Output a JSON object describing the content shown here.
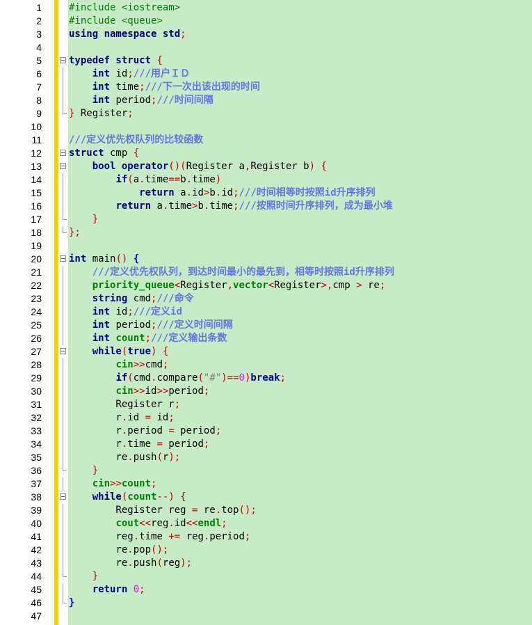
{
  "editor": {
    "lines": [
      {
        "n": "1",
        "fold": "none",
        "segs": [
          [
            "pp",
            "#include <iostream>"
          ]
        ]
      },
      {
        "n": "2",
        "fold": "none",
        "segs": [
          [
            "pp",
            "#include <queue>"
          ]
        ]
      },
      {
        "n": "3",
        "fold": "none",
        "segs": [
          [
            "kw",
            "using namespace "
          ],
          [
            "kw",
            "std"
          ],
          [
            "op",
            ";"
          ]
        ]
      },
      {
        "n": "4",
        "fold": "none",
        "segs": []
      },
      {
        "n": "5",
        "fold": "open",
        "segs": [
          [
            "kw",
            "typedef struct "
          ],
          [
            "op",
            "{"
          ]
        ]
      },
      {
        "n": "6",
        "fold": "line",
        "segs": [
          [
            "fn",
            "    "
          ],
          [
            "kw",
            "int"
          ],
          [
            "fn",
            " id"
          ],
          [
            "op",
            ";"
          ],
          [
            "cm",
            "///用户ＩＤ"
          ]
        ]
      },
      {
        "n": "7",
        "fold": "line",
        "segs": [
          [
            "fn",
            "    "
          ],
          [
            "kw",
            "int"
          ],
          [
            "fn",
            " time"
          ],
          [
            "op",
            ";"
          ],
          [
            "cm",
            "///下一次出该出现的时间"
          ]
        ]
      },
      {
        "n": "8",
        "fold": "line",
        "segs": [
          [
            "fn",
            "    "
          ],
          [
            "kw",
            "int"
          ],
          [
            "fn",
            " period"
          ],
          [
            "op",
            ";"
          ],
          [
            "cm",
            "///时间间隔"
          ]
        ]
      },
      {
        "n": "9",
        "fold": "end",
        "segs": [
          [
            "op",
            "}"
          ],
          [
            "fn",
            " Register"
          ],
          [
            "op",
            ";"
          ]
        ]
      },
      {
        "n": "10",
        "fold": "none",
        "segs": []
      },
      {
        "n": "11",
        "fold": "none",
        "segs": [
          [
            "cm",
            "///定义优先权队列的比较函数"
          ]
        ]
      },
      {
        "n": "12",
        "fold": "open",
        "segs": [
          [
            "kw",
            "struct"
          ],
          [
            "fn",
            " cmp "
          ],
          [
            "op",
            "{"
          ]
        ]
      },
      {
        "n": "13",
        "fold": "open",
        "segs": [
          [
            "fn",
            "    "
          ],
          [
            "kw",
            "bool operator"
          ],
          [
            "op",
            "()("
          ],
          [
            "fn",
            "Register a"
          ],
          [
            "op",
            ","
          ],
          [
            "fn",
            "Register b"
          ],
          [
            "op",
            ") {"
          ]
        ]
      },
      {
        "n": "14",
        "fold": "line",
        "segs": [
          [
            "fn",
            "        "
          ],
          [
            "kw",
            "if"
          ],
          [
            "op",
            "("
          ],
          [
            "fn",
            "a"
          ],
          [
            "op",
            "."
          ],
          [
            "fn",
            "time"
          ],
          [
            "op",
            "=="
          ],
          [
            "fn",
            "b"
          ],
          [
            "op",
            "."
          ],
          [
            "fn",
            "time"
          ],
          [
            "op",
            ")"
          ]
        ]
      },
      {
        "n": "15",
        "fold": "line",
        "segs": [
          [
            "fn",
            "            "
          ],
          [
            "kw",
            "return"
          ],
          [
            "fn",
            " a"
          ],
          [
            "op",
            "."
          ],
          [
            "fn",
            "id"
          ],
          [
            "op",
            ">"
          ],
          [
            "fn",
            "b"
          ],
          [
            "op",
            "."
          ],
          [
            "fn",
            "id"
          ],
          [
            "op",
            ";"
          ],
          [
            "cm",
            "///时间相等时按照id升序排列"
          ]
        ]
      },
      {
        "n": "16",
        "fold": "line",
        "segs": [
          [
            "fn",
            "        "
          ],
          [
            "kw",
            "return"
          ],
          [
            "fn",
            " a"
          ],
          [
            "op",
            "."
          ],
          [
            "fn",
            "time"
          ],
          [
            "op",
            ">"
          ],
          [
            "fn",
            "b"
          ],
          [
            "op",
            "."
          ],
          [
            "fn",
            "time"
          ],
          [
            "op",
            ";"
          ],
          [
            "cm",
            "///按照时间升序排列，成为最小堆"
          ]
        ]
      },
      {
        "n": "17",
        "fold": "end",
        "segs": [
          [
            "fn",
            "    "
          ],
          [
            "op",
            "}"
          ]
        ]
      },
      {
        "n": "18",
        "fold": "end",
        "segs": [
          [
            "op",
            "};"
          ]
        ]
      },
      {
        "n": "19",
        "fold": "none",
        "segs": []
      },
      {
        "n": "20",
        "fold": "open",
        "segs": [
          [
            "kw",
            "int"
          ],
          [
            "fn",
            " main"
          ],
          [
            "op",
            "() "
          ],
          [
            "br",
            "{"
          ]
        ]
      },
      {
        "n": "21",
        "fold": "line",
        "segs": [
          [
            "fn",
            "    "
          ],
          [
            "cm",
            "///定义优先权队列，到达时间最小的最先到，相等时按照id升序排列"
          ]
        ]
      },
      {
        "n": "22",
        "fold": "line",
        "segs": [
          [
            "fn",
            "    "
          ],
          [
            "ty",
            "priority_queue"
          ],
          [
            "op",
            "<"
          ],
          [
            "fn",
            "Register"
          ],
          [
            "op",
            ","
          ],
          [
            "ty",
            "vector"
          ],
          [
            "op",
            "<"
          ],
          [
            "fn",
            "Register"
          ],
          [
            "op",
            ">,"
          ],
          [
            "fn",
            "cmp "
          ],
          [
            "op",
            ">"
          ],
          [
            "fn",
            " re"
          ],
          [
            "op",
            ";"
          ]
        ]
      },
      {
        "n": "23",
        "fold": "line",
        "segs": [
          [
            "fn",
            "    "
          ],
          [
            "kw",
            "string"
          ],
          [
            "fn",
            " cmd"
          ],
          [
            "op",
            ";"
          ],
          [
            "cm",
            "///命令"
          ]
        ]
      },
      {
        "n": "24",
        "fold": "line",
        "segs": [
          [
            "fn",
            "    "
          ],
          [
            "kw",
            "int"
          ],
          [
            "fn",
            " id"
          ],
          [
            "op",
            ";"
          ],
          [
            "cm",
            "///定义id"
          ]
        ]
      },
      {
        "n": "25",
        "fold": "line",
        "segs": [
          [
            "fn",
            "    "
          ],
          [
            "kw",
            "int"
          ],
          [
            "fn",
            " period"
          ],
          [
            "op",
            ";"
          ],
          [
            "cm",
            "///定义时间间隔"
          ]
        ]
      },
      {
        "n": "26",
        "fold": "line",
        "segs": [
          [
            "fn",
            "    "
          ],
          [
            "kw",
            "int"
          ],
          [
            "fn",
            " "
          ],
          [
            "ty",
            "count"
          ],
          [
            "op",
            ";"
          ],
          [
            "cm",
            "///定义输出条数"
          ]
        ]
      },
      {
        "n": "27",
        "fold": "open",
        "segs": [
          [
            "fn",
            "    "
          ],
          [
            "kw",
            "while"
          ],
          [
            "op",
            "("
          ],
          [
            "kw",
            "true"
          ],
          [
            "op",
            ") {"
          ]
        ]
      },
      {
        "n": "28",
        "fold": "line",
        "segs": [
          [
            "fn",
            "        "
          ],
          [
            "ty",
            "cin"
          ],
          [
            "op",
            ">>"
          ],
          [
            "fn",
            "cmd"
          ],
          [
            "op",
            ";"
          ]
        ]
      },
      {
        "n": "29",
        "fold": "line",
        "segs": [
          [
            "fn",
            "        "
          ],
          [
            "kw",
            "if"
          ],
          [
            "op",
            "("
          ],
          [
            "fn",
            "cmd"
          ],
          [
            "op",
            "."
          ],
          [
            "fn",
            "compare"
          ],
          [
            "op",
            "("
          ],
          [
            "str",
            "\"#\""
          ],
          [
            "op",
            ")=="
          ],
          [
            "num",
            "0"
          ],
          [
            "op",
            ")"
          ],
          [
            "kw",
            "break"
          ],
          [
            "op",
            ";"
          ]
        ]
      },
      {
        "n": "30",
        "fold": "line",
        "segs": [
          [
            "fn",
            "        "
          ],
          [
            "ty",
            "cin"
          ],
          [
            "op",
            ">>"
          ],
          [
            "fn",
            "id"
          ],
          [
            "op",
            ">>"
          ],
          [
            "fn",
            "period"
          ],
          [
            "op",
            ";"
          ]
        ]
      },
      {
        "n": "31",
        "fold": "line",
        "segs": [
          [
            "fn",
            "        Register r"
          ],
          [
            "op",
            ";"
          ]
        ]
      },
      {
        "n": "32",
        "fold": "line",
        "segs": [
          [
            "fn",
            "        r"
          ],
          [
            "op",
            "."
          ],
          [
            "fn",
            "id "
          ],
          [
            "op",
            "="
          ],
          [
            "fn",
            " id"
          ],
          [
            "op",
            ";"
          ]
        ]
      },
      {
        "n": "33",
        "fold": "line",
        "segs": [
          [
            "fn",
            "        r"
          ],
          [
            "op",
            "."
          ],
          [
            "fn",
            "period "
          ],
          [
            "op",
            "="
          ],
          [
            "fn",
            " period"
          ],
          [
            "op",
            ";"
          ]
        ]
      },
      {
        "n": "34",
        "fold": "line",
        "segs": [
          [
            "fn",
            "        r"
          ],
          [
            "op",
            "."
          ],
          [
            "fn",
            "time "
          ],
          [
            "op",
            "="
          ],
          [
            "fn",
            " period"
          ],
          [
            "op",
            ";"
          ]
        ]
      },
      {
        "n": "35",
        "fold": "line",
        "segs": [
          [
            "fn",
            "        re"
          ],
          [
            "op",
            "."
          ],
          [
            "fn",
            "push"
          ],
          [
            "op",
            "("
          ],
          [
            "fn",
            "r"
          ],
          [
            "op",
            ");"
          ]
        ]
      },
      {
        "n": "36",
        "fold": "end",
        "segs": [
          [
            "fn",
            "    "
          ],
          [
            "op",
            "}"
          ]
        ]
      },
      {
        "n": "37",
        "fold": "line",
        "segs": [
          [
            "fn",
            "    "
          ],
          [
            "ty",
            "cin"
          ],
          [
            "op",
            ">>"
          ],
          [
            "ty",
            "count"
          ],
          [
            "op",
            ";"
          ]
        ]
      },
      {
        "n": "38",
        "fold": "open",
        "segs": [
          [
            "fn",
            "    "
          ],
          [
            "kw",
            "while"
          ],
          [
            "op",
            "("
          ],
          [
            "ty",
            "count"
          ],
          [
            "op",
            "--) {"
          ]
        ]
      },
      {
        "n": "39",
        "fold": "line",
        "segs": [
          [
            "fn",
            "        Register reg "
          ],
          [
            "op",
            "="
          ],
          [
            "fn",
            " re"
          ],
          [
            "op",
            "."
          ],
          [
            "fn",
            "top"
          ],
          [
            "op",
            "();"
          ]
        ]
      },
      {
        "n": "40",
        "fold": "line",
        "segs": [
          [
            "fn",
            "        "
          ],
          [
            "ty",
            "cout"
          ],
          [
            "op",
            "<<"
          ],
          [
            "fn",
            "reg"
          ],
          [
            "op",
            "."
          ],
          [
            "fn",
            "id"
          ],
          [
            "op",
            "<<"
          ],
          [
            "ty",
            "endl"
          ],
          [
            "op",
            ";"
          ]
        ]
      },
      {
        "n": "41",
        "fold": "line",
        "segs": [
          [
            "fn",
            "        reg"
          ],
          [
            "op",
            "."
          ],
          [
            "fn",
            "time "
          ],
          [
            "op",
            "+="
          ],
          [
            "fn",
            " reg"
          ],
          [
            "op",
            "."
          ],
          [
            "fn",
            "period"
          ],
          [
            "op",
            ";"
          ]
        ]
      },
      {
        "n": "42",
        "fold": "line",
        "segs": [
          [
            "fn",
            "        re"
          ],
          [
            "op",
            "."
          ],
          [
            "fn",
            "pop"
          ],
          [
            "op",
            "();"
          ]
        ]
      },
      {
        "n": "43",
        "fold": "line",
        "segs": [
          [
            "fn",
            "        re"
          ],
          [
            "op",
            "."
          ],
          [
            "fn",
            "push"
          ],
          [
            "op",
            "("
          ],
          [
            "fn",
            "reg"
          ],
          [
            "op",
            ");"
          ]
        ]
      },
      {
        "n": "44",
        "fold": "end",
        "segs": [
          [
            "fn",
            "    "
          ],
          [
            "op",
            "}"
          ]
        ]
      },
      {
        "n": "45",
        "fold": "line",
        "segs": [
          [
            "fn",
            "    "
          ],
          [
            "kw",
            "return"
          ],
          [
            "fn",
            " "
          ],
          [
            "num",
            "0"
          ],
          [
            "op",
            ";"
          ]
        ]
      },
      {
        "n": "46",
        "fold": "end",
        "segs": [
          [
            "br",
            "}"
          ]
        ]
      },
      {
        "n": "47",
        "fold": "none",
        "segs": []
      }
    ]
  }
}
